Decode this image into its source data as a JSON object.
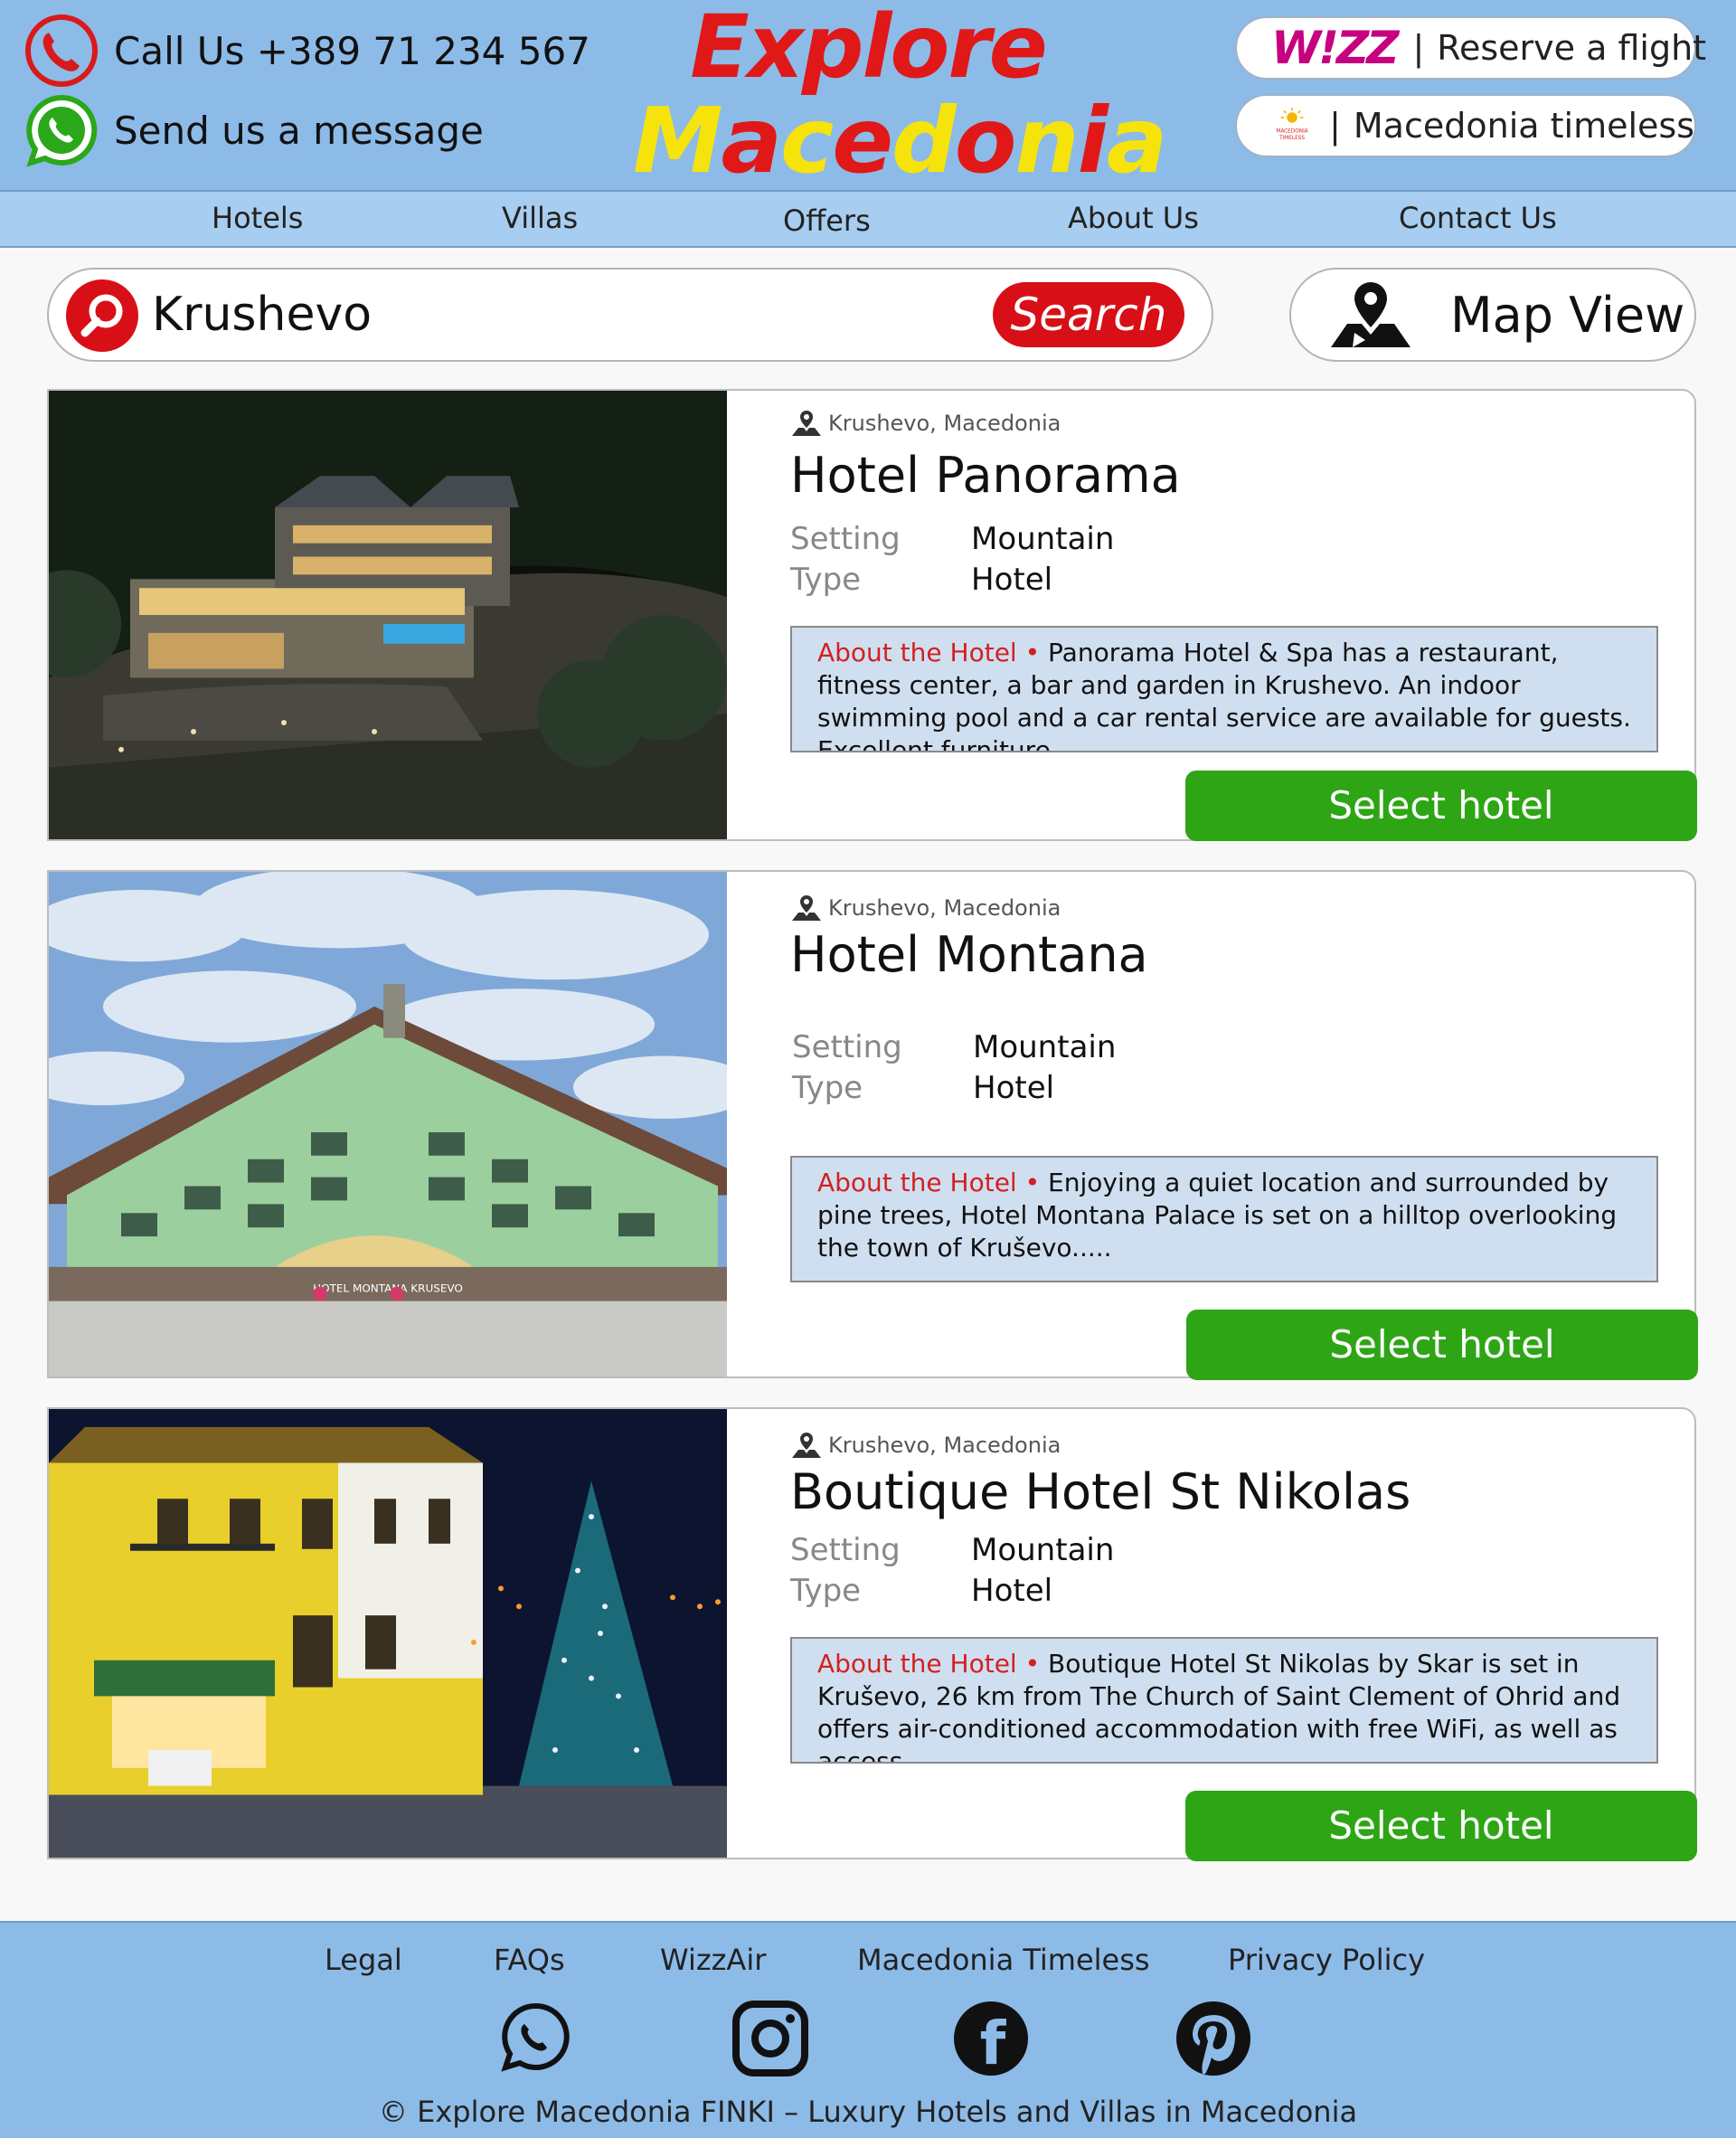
{
  "header": {
    "call_text": "Call Us +389 71 234 567",
    "message_text": "Send us a message",
    "logo_line1": "Explore",
    "logo_line2_parts": [
      "M",
      "a",
      "c",
      "e",
      "d",
      "o",
      "n",
      "i",
      "a"
    ],
    "wizz_logo": "W!ZZ",
    "wizz_label": "Reserve a flight",
    "timeless_label": "Macedonia timeless",
    "timeless_logo_text": "MACEDONIA TIMELESS",
    "separator": "|"
  },
  "nav": {
    "items": [
      "Hotels",
      "Villas",
      "Offers",
      "About Us",
      "Contact Us"
    ]
  },
  "search": {
    "value": "Krushevo",
    "button_label": "Search",
    "map_view_label": "Map View"
  },
  "hotels": [
    {
      "location": "Krushevo, Macedonia",
      "name": "Hotel Panorama",
      "setting_label": "Setting",
      "setting": "Mountain",
      "type_label": "Type",
      "type": "Hotel",
      "about_head": "About the Hotel",
      "bullet": "•",
      "about": "Panorama Hotel & Spa has a restaurant, fitness center, a bar and garden in Krushevo. An indoor swimming pool and a car rental service are available for guests. Excellent furniture....",
      "button": "Select hotel"
    },
    {
      "location": "Krushevo, Macedonia",
      "name": "Hotel Montana",
      "setting_label": "Setting",
      "setting": "Mountain",
      "type_label": "Type",
      "type": "Hotel",
      "about_head": "About the Hotel",
      "bullet": "•",
      "about": "Enjoying a quiet location and surrounded by pine trees, Hotel Montana Palace is set on a hilltop overlooking the town of Kruševo.....",
      "sign_text": "HOTEL MONTANA KRUSEVO",
      "button": "Select hotel"
    },
    {
      "location": "Krushevo, Macedonia",
      "name": "Boutique Hotel St Nikolas",
      "setting_label": "Setting",
      "setting": "Mountain",
      "type_label": "Type",
      "type": "Hotel",
      "about_head": "About the Hotel",
      "bullet": "•",
      "about": "Boutique Hotel St Nikolas by Skar is set in Kruševo, 26 km from The Church of Saint Clement of Ohrid and offers air-conditioned accommodation with free WiFi, as well as access....",
      "button": "Select hotel"
    }
  ],
  "footer": {
    "links": [
      "Legal",
      "FAQs",
      "WizzAir",
      "Macedonia Timeless",
      "Privacy Policy"
    ],
    "social_icons": [
      "whatsapp-icon",
      "instagram-icon",
      "facebook-icon",
      "pinterest-icon"
    ],
    "facebook_glyph": "f",
    "copyright": "© Explore Macedonia FINKI – Luxury Hotels and Villas in Macedonia"
  },
  "colors": {
    "header_bg": "#8dbbe8",
    "nav_bg": "#a7cdf0",
    "accent_red": "#d80f16",
    "select_green": "#2ea515",
    "about_bg": "#cfdff0",
    "logo_yellow": "#f7e30c"
  }
}
